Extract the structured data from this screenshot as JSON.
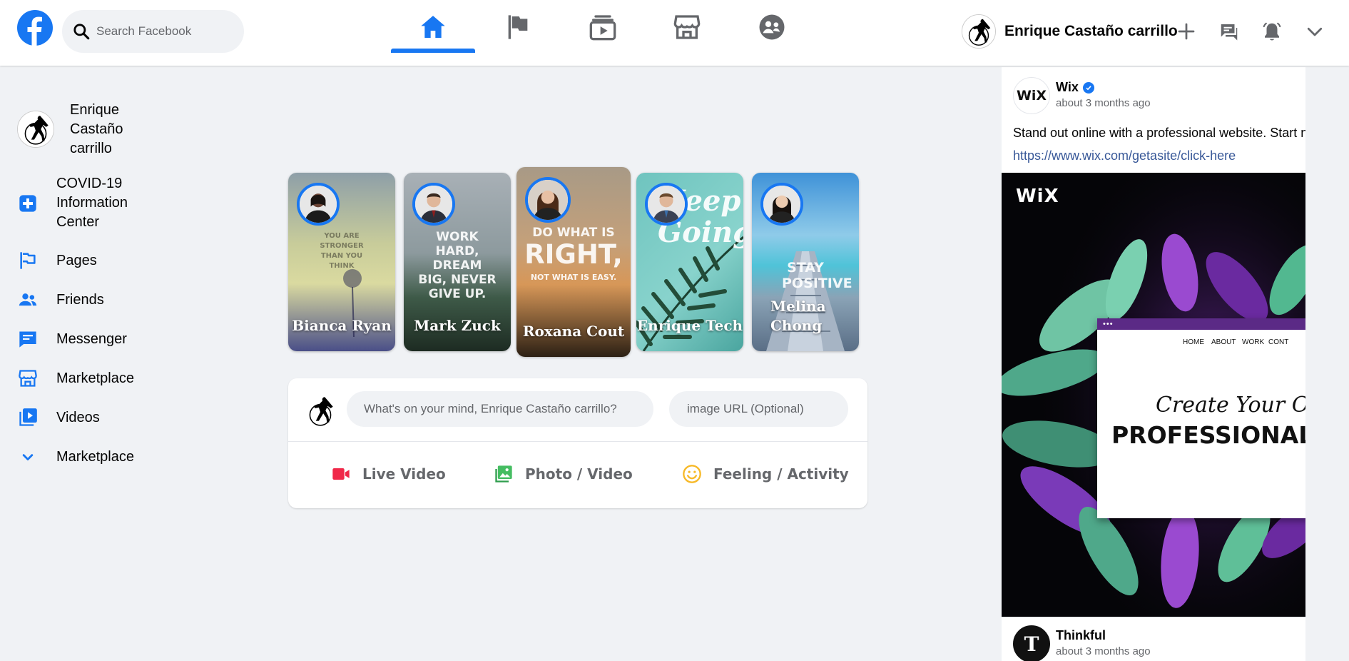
{
  "header": {
    "search_placeholder": "Search Facebook",
    "nav_tabs": [
      {
        "name": "home",
        "active": true
      },
      {
        "name": "pages"
      },
      {
        "name": "watch"
      },
      {
        "name": "marketplace"
      },
      {
        "name": "groups"
      }
    ],
    "profile_name": "Enrique Castaño carrillo"
  },
  "sidebar": {
    "profile_name": "Enrique Castaño carrillo",
    "items": [
      {
        "label": "COVID-19 Information Center",
        "icon": "plus-square-icon"
      },
      {
        "label": "Pages",
        "icon": "flag-icon"
      },
      {
        "label": "Friends",
        "icon": "friends-icon"
      },
      {
        "label": "Messenger",
        "icon": "chat-icon"
      },
      {
        "label": "Marketplace",
        "icon": "store-icon"
      },
      {
        "label": "Videos",
        "icon": "video-icon"
      },
      {
        "label": "Marketplace",
        "icon": "chevron-down-icon"
      }
    ]
  },
  "stories": [
    {
      "name": "Bianca Ryan",
      "quote": "You are stronger than you think"
    },
    {
      "name": "Mark Zuck",
      "quote": "Work hard, dream big, never give up."
    },
    {
      "name": "Roxana Cout",
      "quote_small_top": "Do what is",
      "quote_big": "Right,",
      "quote_small_bottom": "Not what is easy."
    },
    {
      "name": "Enrique Tech",
      "quote": "Keep Going"
    },
    {
      "name": "Melina Chong",
      "quote": "Stay positive"
    }
  ],
  "composer": {
    "post_placeholder": "What's on your mind, Enrique Castaño carrillo?",
    "url_placeholder": "image URL (Optional)",
    "actions": [
      {
        "label": "Live Video",
        "color": "#f02849"
      },
      {
        "label": "Photo / Video",
        "color": "#45bd62"
      },
      {
        "label": "Feeling / Activity",
        "color": "#f7b928"
      }
    ]
  },
  "feed": {
    "posts": [
      {
        "author": "Wix",
        "avatar_text": "WiX",
        "time": "about 3 months ago",
        "text": "Stand out online with a professional website. Start no",
        "link": "https://www.wix.com/getasite/click-here",
        "ad": {
          "logo": "WiX",
          "menu": [
            "HOME",
            "ABOUT",
            "WORK",
            "CONT"
          ],
          "dots": "•••",
          "headline1": "Create Your O",
          "headline2": "PROFESSIONAL W"
        }
      },
      {
        "author": "Thinkful",
        "avatar_text": "T",
        "time": "about 3 months ago"
      }
    ]
  },
  "colors": {
    "brand": "#1877f2",
    "background": "#f0f2f5",
    "secondary_text": "#65676b",
    "link": "#385898"
  }
}
